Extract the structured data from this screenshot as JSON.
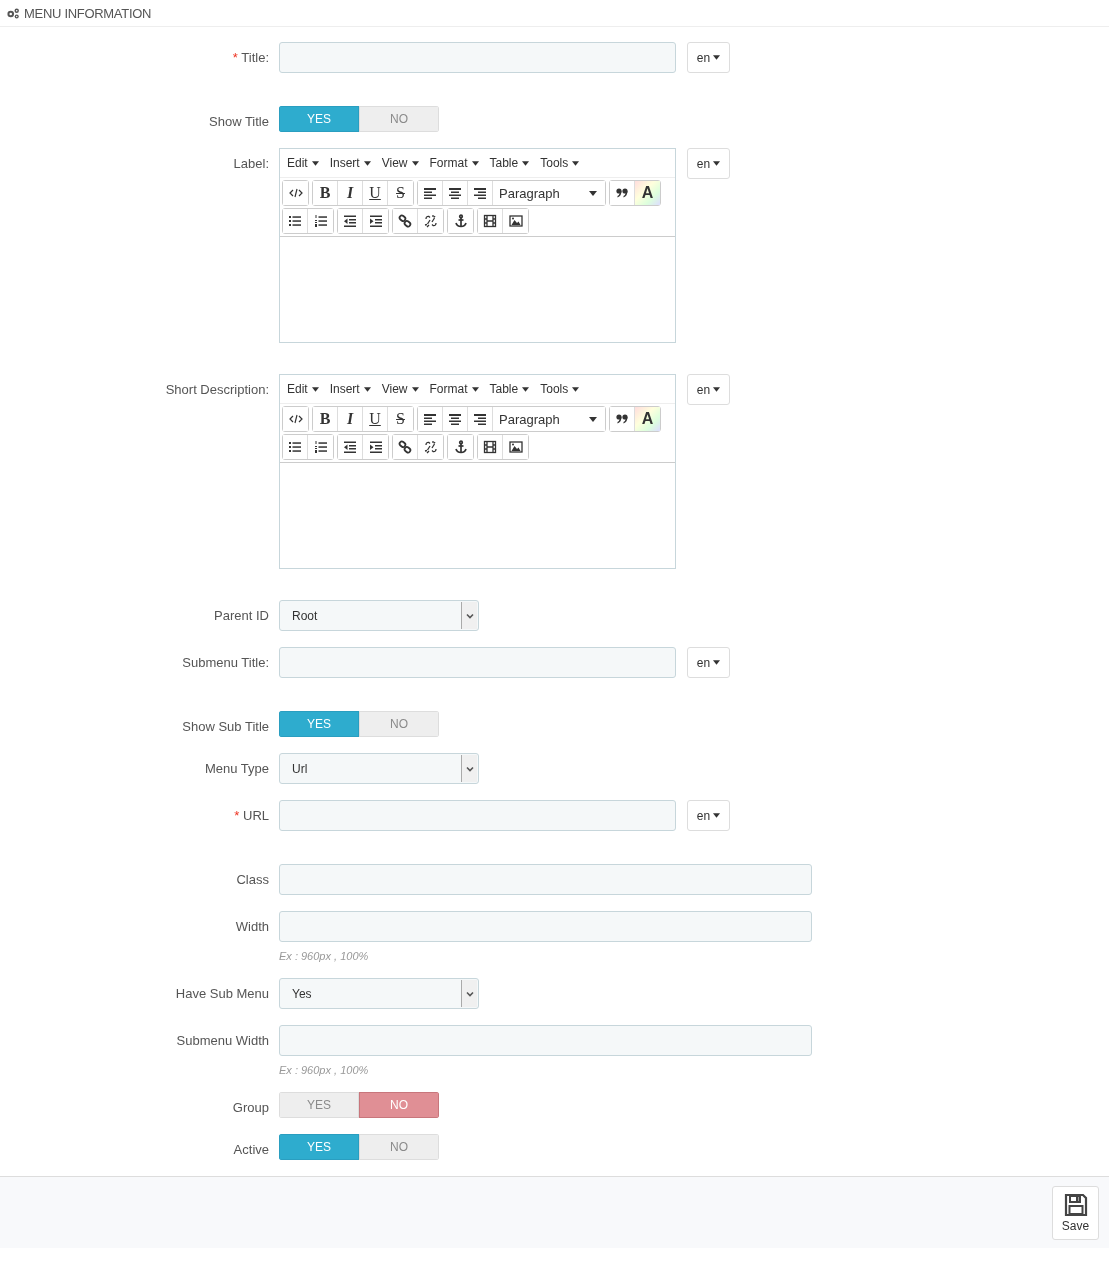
{
  "panel": {
    "title": "MENU INFORMATION"
  },
  "fields": [
    {
      "kind": "text",
      "label": "Title:",
      "required_mark": "*",
      "lang": "en"
    },
    {
      "kind": "toggle",
      "label": "Show Title",
      "options": [
        {
          "label": "YES",
          "selected": true
        },
        {
          "label": "NO",
          "selected": false
        }
      ]
    },
    {
      "kind": "editor",
      "label": "Label:",
      "lang": "en",
      "menus": [
        "Edit",
        "Insert",
        "View",
        "Format",
        "Table",
        "Tools"
      ],
      "toolbar": [
        [
          [
            {
              "kind": "code"
            }
          ],
          [
            {
              "kind": "bold",
              "text": "B"
            },
            {
              "kind": "italic",
              "text": "I"
            },
            {
              "kind": "underline",
              "text": "U"
            },
            {
              "kind": "strike",
              "text": "S"
            }
          ],
          [
            {
              "kind": "align-left"
            },
            {
              "kind": "align-center"
            },
            {
              "kind": "align-right"
            },
            {
              "kind": "select",
              "text": "Paragraph"
            }
          ],
          [
            {
              "kind": "quote"
            },
            {
              "kind": "color",
              "text": "A"
            }
          ]
        ],
        [
          [
            {
              "kind": "bullets"
            },
            {
              "kind": "numbers"
            }
          ],
          [
            {
              "kind": "outdent"
            },
            {
              "kind": "indent"
            }
          ],
          [
            {
              "kind": "link"
            },
            {
              "kind": "unlink"
            }
          ],
          [
            {
              "kind": "anchor"
            }
          ],
          [
            {
              "kind": "film"
            },
            {
              "kind": "image"
            }
          ]
        ]
      ]
    },
    {
      "kind": "editor",
      "label": "Short Description:",
      "lang": "en",
      "menus": [
        "Edit",
        "Insert",
        "View",
        "Format",
        "Table",
        "Tools"
      ],
      "toolbar": [
        [
          [
            {
              "kind": "code"
            }
          ],
          [
            {
              "kind": "bold",
              "text": "B"
            },
            {
              "kind": "italic",
              "text": "I"
            },
            {
              "kind": "underline",
              "text": "U"
            },
            {
              "kind": "strike",
              "text": "S"
            }
          ],
          [
            {
              "kind": "align-left"
            },
            {
              "kind": "align-center"
            },
            {
              "kind": "align-right"
            },
            {
              "kind": "select",
              "text": "Paragraph"
            }
          ],
          [
            {
              "kind": "quote"
            },
            {
              "kind": "color",
              "text": "A"
            }
          ]
        ],
        [
          [
            {
              "kind": "bullets"
            },
            {
              "kind": "numbers"
            }
          ],
          [
            {
              "kind": "outdent"
            },
            {
              "kind": "indent"
            }
          ],
          [
            {
              "kind": "link"
            },
            {
              "kind": "unlink"
            }
          ],
          [
            {
              "kind": "anchor"
            }
          ],
          [
            {
              "kind": "film"
            },
            {
              "kind": "image"
            }
          ]
        ]
      ]
    },
    {
      "kind": "select",
      "label": "Parent ID",
      "value": "Root"
    },
    {
      "kind": "text",
      "label": "Submenu Title:",
      "lang": "en"
    },
    {
      "kind": "toggle",
      "label": "Show Sub Title",
      "options": [
        {
          "label": "YES",
          "selected": true
        },
        {
          "label": "NO",
          "selected": false
        }
      ]
    },
    {
      "kind": "select",
      "label": "Menu Type",
      "value": "Url"
    },
    {
      "kind": "text",
      "label": "URL",
      "required_mark": "*",
      "lang": "en"
    },
    {
      "kind": "text",
      "label": "Class"
    },
    {
      "kind": "text",
      "label": "Width",
      "help": "Ex : 960px , 100%"
    },
    {
      "kind": "select",
      "label": "Have Sub Menu",
      "value": "Yes"
    },
    {
      "kind": "text",
      "label": "Submenu Width",
      "help": "Ex : 960px , 100%"
    },
    {
      "kind": "toggle",
      "label": "Group",
      "options": [
        {
          "label": "YES",
          "selected": false
        },
        {
          "label": "NO",
          "selected": true
        }
      ]
    },
    {
      "kind": "toggle",
      "label": "Active",
      "options": [
        {
          "label": "YES",
          "selected": true
        },
        {
          "label": "NO",
          "selected": false
        }
      ]
    }
  ],
  "footer": {
    "save": "Save"
  }
}
